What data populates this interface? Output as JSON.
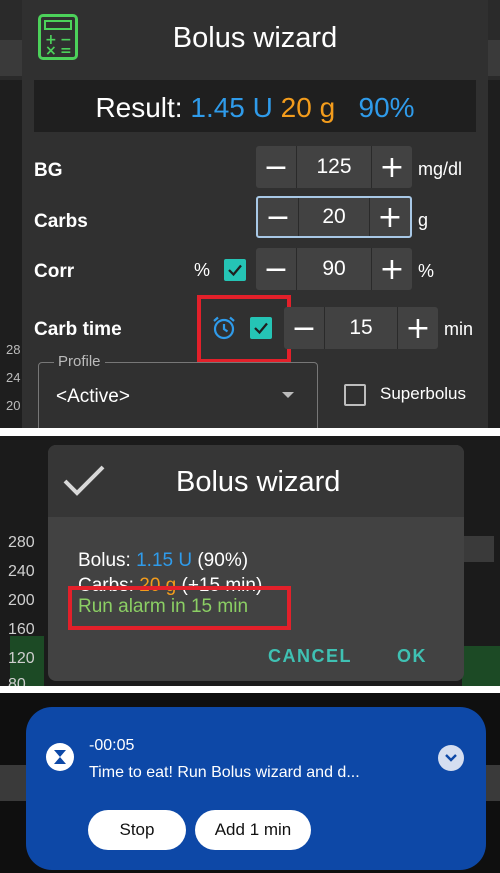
{
  "wizard": {
    "title": "Bolus wizard",
    "result": {
      "label": "Result:",
      "insulin": "1.45 U",
      "carbs": "20 g",
      "percent": "90%"
    },
    "bg": {
      "label": "BG",
      "value": "125",
      "unit": "mg/dl"
    },
    "carbs": {
      "label": "Carbs",
      "value": "20",
      "unit": "g"
    },
    "corr": {
      "label": "Corr",
      "percent_sign": "%",
      "value": "90",
      "unit": "%"
    },
    "carb_time": {
      "label": "Carb time",
      "value": "15",
      "unit": "min"
    },
    "profile": {
      "label": "Profile",
      "value": "<Active>"
    },
    "superbolus": {
      "label": "Superbolus"
    },
    "background_numbers": [
      "28",
      "24",
      "20"
    ]
  },
  "confirm": {
    "title": "Bolus wizard",
    "bolus_label": "Bolus: ",
    "bolus_value": "1.15 U",
    "bolus_pct": " (90%)",
    "carbs_label": "Carbs: ",
    "carbs_value": "20 g",
    "carbs_extra": " (+15 min)",
    "alarm": "Run alarm in 15 min",
    "cancel": "CANCEL",
    "ok": "OK",
    "axis_labels": [
      "280",
      "240",
      "200",
      "160",
      "120",
      "80"
    ]
  },
  "notification": {
    "time": "-00:05",
    "text": "Time to eat! Run Bolus wizard and d...",
    "stop": "Stop",
    "add": "Add 1 min"
  },
  "colors": {
    "insulin_blue": "#2f9bea",
    "carbs_orange": "#f39c1c",
    "alarm_green": "#8bcf64",
    "accent_teal": "#3fc1b3",
    "highlight_red": "#e3202a",
    "notification_blue": "#0d48a7"
  }
}
